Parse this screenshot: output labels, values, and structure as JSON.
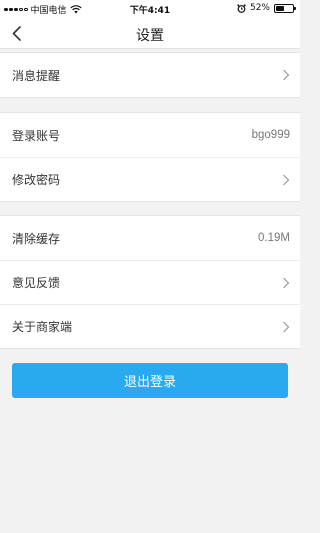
{
  "status_bar": {
    "carrier": "中国电信",
    "time": "下午4:41",
    "battery_percent": "52%",
    "battery_level": 0.52
  },
  "nav": {
    "title": "设置"
  },
  "group1": [
    {
      "label": "消息提醒",
      "value": ""
    }
  ],
  "group2": [
    {
      "label": "登录账号",
      "value": "bgo999"
    },
    {
      "label": "修改密码",
      "value": ""
    }
  ],
  "group3": [
    {
      "label": "清除缓存",
      "value": "0.19M"
    },
    {
      "label": "意见反馈",
      "value": ""
    },
    {
      "label": "关于商家端",
      "value": ""
    }
  ],
  "logout_button": "退出登录",
  "colors": {
    "accent": "#29aaf0",
    "background": "#f2f2f2"
  }
}
